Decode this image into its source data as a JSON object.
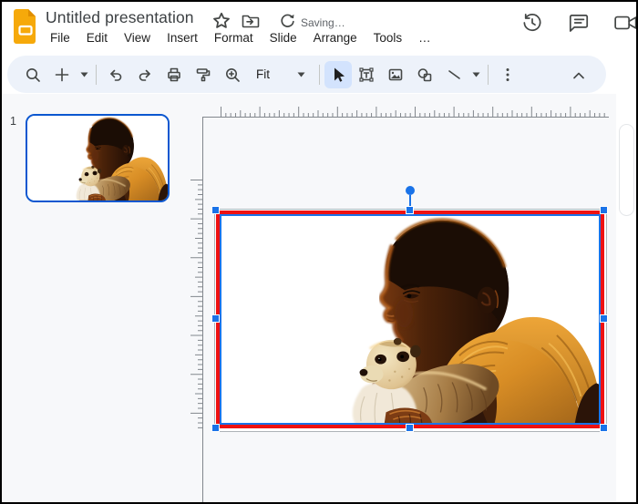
{
  "topbar": {
    "title": "Untitled presentation",
    "saving_status": "Saving…",
    "menus": [
      "File",
      "Edit",
      "View",
      "Insert",
      "Format",
      "Slide",
      "Arrange",
      "Tools",
      "…"
    ]
  },
  "toolbar": {
    "zoom_fit": "Fit"
  },
  "filmstrip": {
    "slide_number": "1"
  },
  "colors": {
    "selection_red": "#ee1111",
    "selection_blue": "#1a73e8",
    "thumb_border": "#0b57d0",
    "pill_bg": "#edf2fa",
    "tool_selected_bg": "#d3e3fd",
    "canvas_bg": "#f7f8fa",
    "icon_gray": "#444746",
    "text_dark": "#1f1f1f",
    "text_gray": "#5f6368",
    "logo_yellow": "#f6a90a",
    "logo_fold": "#e08e00",
    "page_border": "#aeb3b8",
    "ruler_tick": "#82878d"
  }
}
